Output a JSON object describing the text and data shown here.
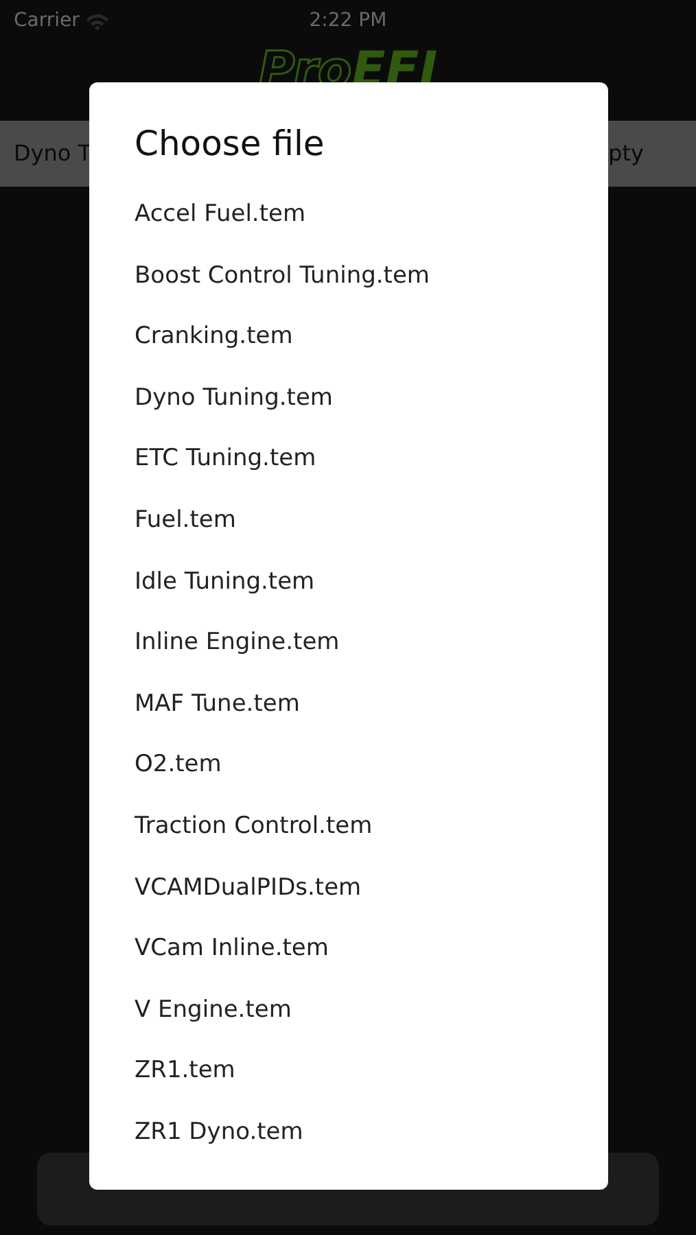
{
  "status_bar": {
    "carrier": "Carrier",
    "time": "2:22 PM"
  },
  "logo": {
    "text_1": "Pro",
    "text_2": "EFI"
  },
  "file_bar": {
    "left": "Dyno T",
    "right": "pty"
  },
  "dialog": {
    "title": "Choose file",
    "files": [
      {
        "name": "Accel Fuel.tem"
      },
      {
        "name": "Boost Control Tuning.tem"
      },
      {
        "name": "Cranking.tem"
      },
      {
        "name": "Dyno Tuning.tem"
      },
      {
        "name": "ETC Tuning.tem"
      },
      {
        "name": "Fuel.tem"
      },
      {
        "name": "Idle Tuning.tem"
      },
      {
        "name": "Inline Engine.tem"
      },
      {
        "name": "MAF Tune.tem"
      },
      {
        "name": "O2.tem"
      },
      {
        "name": "Traction Control.tem"
      },
      {
        "name": "VCAMDualPIDs.tem"
      },
      {
        "name": "VCam Inline.tem"
      },
      {
        "name": "V Engine.tem"
      },
      {
        "name": "ZR1.tem"
      },
      {
        "name": "ZR1 Dyno.tem"
      }
    ]
  }
}
